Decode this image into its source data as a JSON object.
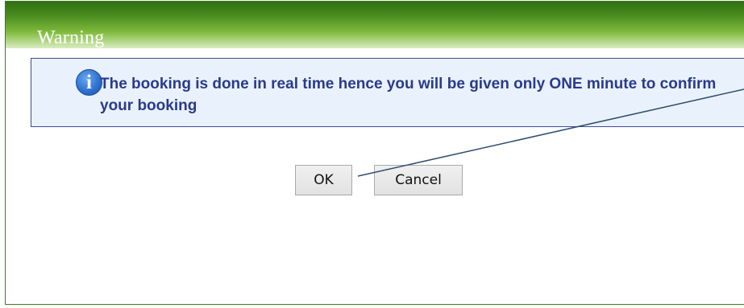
{
  "dialog": {
    "title": "Warning",
    "message": "The booking is done in real time hence you will be given only ONE minute to confirm your booking",
    "info_icon_glyph": "i",
    "icon": "info-icon",
    "buttons": {
      "ok_label": "OK",
      "cancel_label": "Cancel"
    }
  },
  "colors": {
    "title_bar": "#4a8c1f",
    "dialog_border": "#3d7a1e",
    "message_text": "#2a3a8c",
    "info_background": "#e9f2fc",
    "annotation_line": "#2f4f6f"
  }
}
